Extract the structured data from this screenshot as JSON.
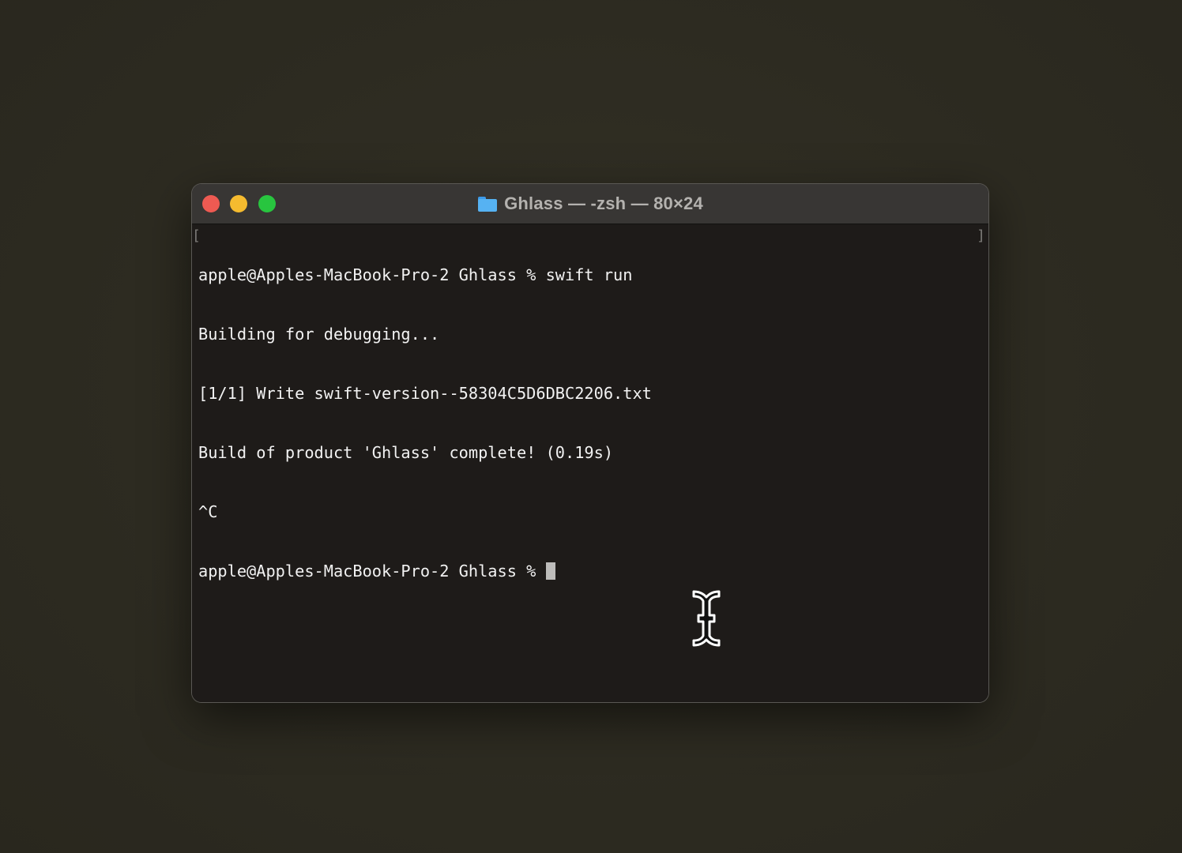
{
  "window": {
    "title": "Ghlass — -zsh — 80×24",
    "folder_icon": "folder-icon"
  },
  "traffic_lights": {
    "close_color": "#ee5a52",
    "minimize_color": "#f5bb2f",
    "zoom_color": "#28c53f"
  },
  "terminal": {
    "lines": [
      "apple@Apples-MacBook-Pro-2 Ghlass % swift run",
      "Building for debugging...",
      "[1/1] Write swift-version--58304C5D6DBC2206.txt",
      "Build of product 'Ghlass' complete! (0.19s)",
      "^C",
      "apple@Apples-MacBook-Pro-2 Ghlass % "
    ],
    "mark_left": "[",
    "mark_right": "]"
  },
  "mouse_cursor": "i-beam-cursor-icon"
}
